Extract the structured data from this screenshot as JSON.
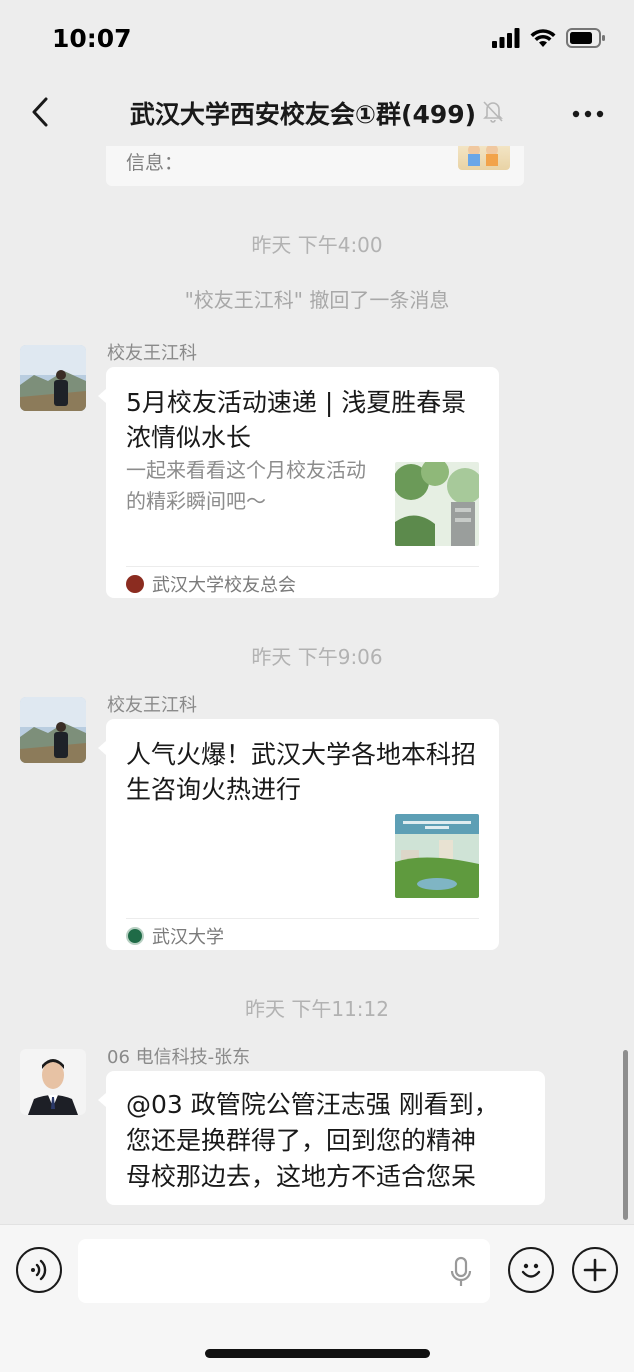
{
  "status_bar": {
    "time": "10:07",
    "icons": [
      "signal-icon",
      "wifi-icon",
      "battery-icon"
    ]
  },
  "nav": {
    "title": "武汉大学西安校友会①群(499)",
    "back_icon": "chevron-left-icon",
    "mute_icon": "bell-off-icon",
    "more_icon": "ellipsis-icon"
  },
  "chat": {
    "partial_card_label": "信息：",
    "messages": [
      {
        "type": "time",
        "text": "昨天 下午4:00"
      },
      {
        "type": "system",
        "text": "\"校友王江科\" 撤回了一条消息"
      },
      {
        "type": "card",
        "sender": "校友王江科",
        "title": "5月校友活动速递 | 浅夏胜春景 浓情似水长",
        "desc": "一起来看看这个月校友活动的精彩瞬间吧～",
        "source": "武汉大学校友总会"
      },
      {
        "type": "time",
        "text": "昨天 下午9:06"
      },
      {
        "type": "card",
        "sender": "校友王江科",
        "title": "人气火爆！武汉大学各地本科招生咨询火热进行",
        "source": "武汉大学"
      },
      {
        "type": "time",
        "text": "昨天 下午11:12"
      },
      {
        "type": "text",
        "sender": "06 电信科技-张东",
        "lines": [
          "@03 政管院公管汪志强 刚看到，",
          "您还是换群得了，回到您的精神",
          "母校那边去，这地方不适合您呆"
        ]
      }
    ]
  },
  "input_bar": {
    "voice_icon": "voice-icon",
    "mic_icon": "microphone-icon",
    "emoji_icon": "emoji-icon",
    "plus_icon": "plus-icon",
    "input_value": ""
  },
  "colors": {
    "background": "#ededed",
    "bubble": "#ffffff",
    "time_label": "#b2b2b2",
    "sender": "#8a8a8a"
  }
}
